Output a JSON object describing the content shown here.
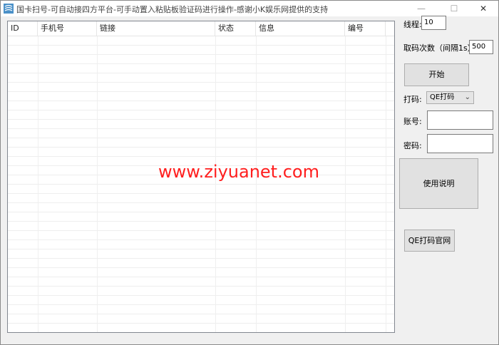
{
  "window": {
    "title": "国卡扫号-可自动接四方平台-可手动置入粘贴板验证码进行操作-感谢小K娱乐网提供的支持",
    "min_glyph": "—",
    "max_glyph": "☐",
    "close_glyph": "✕"
  },
  "table": {
    "columns": [
      "ID",
      "手机号",
      "链接",
      "状态",
      "信息",
      "编号"
    ]
  },
  "watermark": "www.ziyuanet.com",
  "settings": {
    "threads_label": "线程:",
    "threads_value": "10",
    "fetch_label": "取码次数（间隔1s）",
    "fetch_value": "500",
    "start_button": "开始",
    "captcha_label": "打码:",
    "captcha_selected": "QE打码",
    "account_label": "账号:",
    "account_value": "",
    "password_label": "密码:",
    "password_value": "",
    "help_button": "使用说明",
    "site_button": "QE打码官网"
  }
}
